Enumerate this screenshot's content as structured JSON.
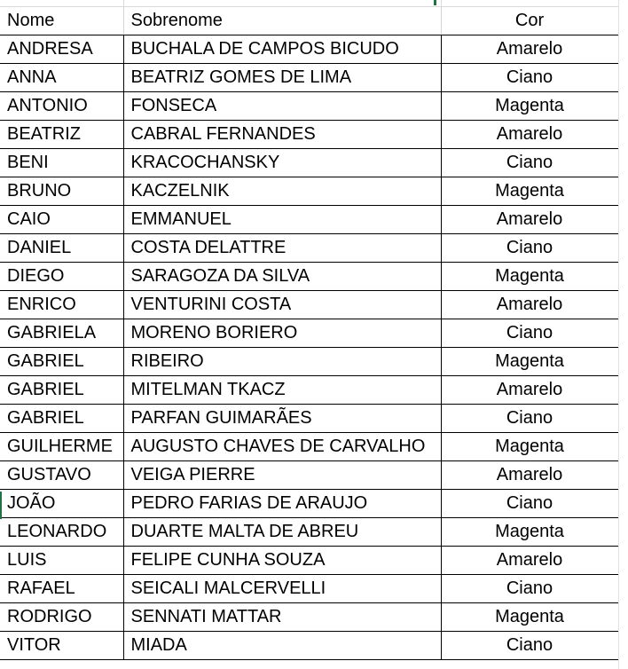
{
  "sheet": {
    "headers": {
      "nome": "Nome",
      "sobrenome": "Sobrenome",
      "cor": "Cor"
    },
    "rows": [
      {
        "nome": "ANDRESA",
        "sobrenome": "BUCHALA DE CAMPOS BICUDO",
        "cor": "Amarelo"
      },
      {
        "nome": "ANNA",
        "sobrenome": "BEATRIZ GOMES DE LIMA",
        "cor": "Ciano"
      },
      {
        "nome": "ANTONIO",
        "sobrenome": "FONSECA",
        "cor": "Magenta"
      },
      {
        "nome": "BEATRIZ",
        "sobrenome": "CABRAL FERNANDES",
        "cor": "Amarelo"
      },
      {
        "nome": "BENI",
        "sobrenome": "KRACOCHANSKY",
        "cor": "Ciano"
      },
      {
        "nome": "BRUNO",
        "sobrenome": "KACZELNIK",
        "cor": "Magenta"
      },
      {
        "nome": "CAIO",
        "sobrenome": "EMMANUEL",
        "cor": "Amarelo"
      },
      {
        "nome": "DANIEL",
        "sobrenome": "COSTA DELATTRE",
        "cor": "Ciano"
      },
      {
        "nome": "DIEGO",
        "sobrenome": "SARAGOZA DA SILVA",
        "cor": "Magenta"
      },
      {
        "nome": "ENRICO",
        "sobrenome": "VENTURINI COSTA",
        "cor": "Amarelo"
      },
      {
        "nome": "GABRIELA",
        "sobrenome": "MORENO BORIERO",
        "cor": "Ciano"
      },
      {
        "nome": "GABRIEL",
        "sobrenome": "RIBEIRO",
        "cor": "Magenta"
      },
      {
        "nome": "GABRIEL",
        "sobrenome": "MITELMAN TKACZ",
        "cor": "Amarelo"
      },
      {
        "nome": "GABRIEL",
        "sobrenome": "PARFAN GUIMARÃES",
        "cor": "Ciano"
      },
      {
        "nome": "GUILHERME",
        "sobrenome": "AUGUSTO CHAVES DE CARVALHO",
        "cor": "Magenta"
      },
      {
        "nome": "GUSTAVO",
        "sobrenome": "VEIGA PIERRE",
        "cor": "Amarelo"
      },
      {
        "nome": "JOÃO",
        "sobrenome": "PEDRO FARIAS DE ARAUJO",
        "cor": "Ciano"
      },
      {
        "nome": "LEONARDO",
        "sobrenome": "DUARTE MALTA DE ABREU",
        "cor": "Magenta"
      },
      {
        "nome": "LUIS",
        "sobrenome": "FELIPE CUNHA SOUZA",
        "cor": "Amarelo"
      },
      {
        "nome": "RAFAEL",
        "sobrenome": "SEICALI MALCERVELLI",
        "cor": "Ciano"
      },
      {
        "nome": "RODRIGO",
        "sobrenome": "SENNATI MATTAR",
        "cor": "Magenta"
      },
      {
        "nome": "VITOR",
        "sobrenome": "MIADA",
        "cor": "Ciano"
      }
    ]
  },
  "colors": {
    "gridline": "#000000",
    "faint_gridline": "#d9d9d9",
    "selection_accent": "#217346",
    "text": "#000000",
    "background": "#ffffff"
  }
}
